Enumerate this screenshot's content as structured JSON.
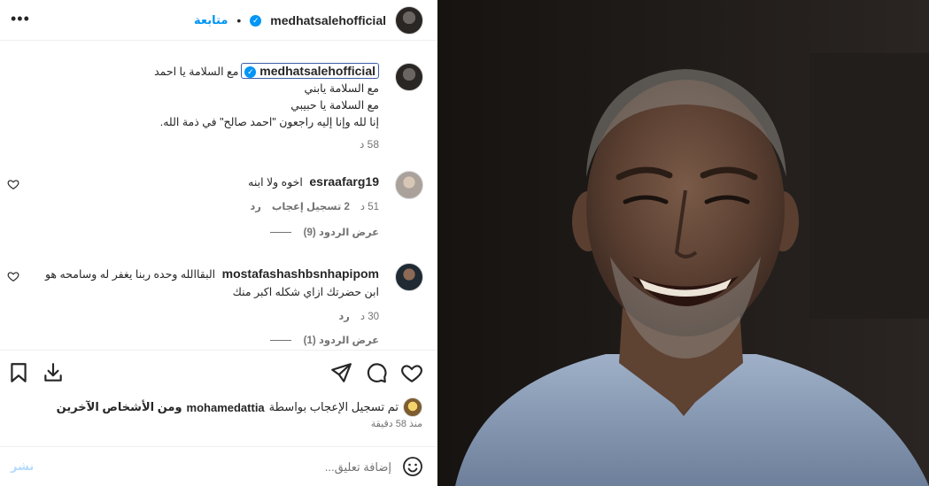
{
  "header": {
    "username": "medhatsalehofficial",
    "follow_label": "متابعة",
    "separator": "•",
    "more_icon": "more-horizontal-icon"
  },
  "caption": {
    "username": "medhatsalehofficial",
    "lines": [
      "مع السلامة يا احمد",
      "مع السلامة يابني",
      "مع السلامة يا حبيبي",
      "إنا لله وإنا إليه راجعون \"احمد صالح\" في ذمة الله."
    ],
    "time": "58 د"
  },
  "comments": [
    {
      "username": "esraafarg19",
      "text": "اخوه ولا ابنه",
      "time": "51 د",
      "likes": "2 تسجيل إعجاب",
      "reply": "رد",
      "view_replies": "عرض الردود (9)"
    },
    {
      "username": "mostafashashbsnhapipom",
      "text": "البقاالله وحده ربنا يغفر له وسامحه هو ابن حضرتك ازاي شكله اكبر منك",
      "time": "30 د",
      "reply": "رد",
      "view_replies": "عرض الردود (1)"
    }
  ],
  "actions": {
    "like_icon": "heart-icon",
    "comment_icon": "comment-icon",
    "share_icon": "send-icon",
    "download_icon": "download-icon",
    "save_icon": "bookmark-icon"
  },
  "likes": {
    "prefix": "تم تسجيل الإعجاب بواسطة",
    "username": "mohamedattia",
    "suffix": "ومن الأشخاص الآخرين"
  },
  "posted_ago": "منذ 58 دقيقة",
  "comment_box": {
    "placeholder": "إضافة تعليق...",
    "post_label": "نشر",
    "emoji_icon": "smiley-icon"
  },
  "colors": {
    "link": "#0095f6",
    "text": "#262626",
    "muted": "#737373",
    "post_disabled": "#b3dbff"
  }
}
